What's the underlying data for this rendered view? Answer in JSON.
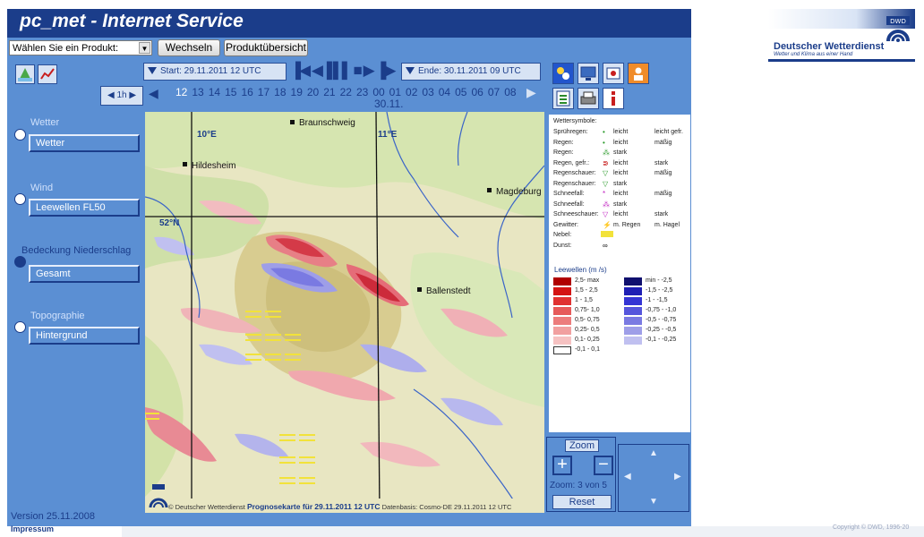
{
  "app": {
    "title": "pc_met - Internet Service",
    "brand_name": "Deutscher Wetterdienst",
    "brand_slogan": "Wetter und Klima aus einer Hand",
    "logo_text": "DWD",
    "colors": {
      "header": "#1b3d8a",
      "panel": "#5b8fd3",
      "field": "#d7e3f4"
    }
  },
  "toolbar": {
    "product_select": "Wählen Sie ein Produkt:",
    "switch_label": "Wechseln",
    "overview_label": "Produktübersicht"
  },
  "timebar": {
    "start": "Start:  29.11.2011 12 UTC",
    "end": "Ende:  30.11.2011 09 UTC",
    "step": "1h",
    "hours": [
      "12",
      "13",
      "14",
      "15",
      "16",
      "17",
      "18",
      "19",
      "20",
      "21",
      "22",
      "23",
      "00",
      "01",
      "02",
      "03",
      "04",
      "05",
      "06",
      "07",
      "08"
    ],
    "active_hour": "12",
    "date_label": "30.11."
  },
  "sidebar": {
    "weather_label": "Wetter",
    "weather_value": "Wetter",
    "wind_label": "Wind",
    "wind_value": "Leewellen FL50",
    "cover_label": "Bedeckung  Niederschlag",
    "cover_value": "Gesamt",
    "topo_label": "Topographie",
    "topo_value": "Hintergrund"
  },
  "map": {
    "cities": [
      "Braunschweig",
      "Hildesheim",
      "Magdeburg",
      "Ballenstedt"
    ],
    "lon1": "10°E",
    "lon2": "11°E",
    "lat1": "52°N",
    "caption_prefix": "© Deutscher Wetterdienst",
    "caption_title": "Prognosekarte für",
    "caption_time": "29.11.2011 12 UTC",
    "caption_basis": "Datenbasis: Cosmo-DE 29.11.2011 12 UTC"
  },
  "legend": {
    "title": "Wettersymbole:",
    "rows": [
      {
        "label": "Sprühregen:",
        "a": "leicht",
        "b": "leicht gefr."
      },
      {
        "label": "Regen:",
        "a": "leicht",
        "b": "mäßig"
      },
      {
        "label": "Regen:",
        "a": "stark",
        "b": ""
      },
      {
        "label": "Regen, gefr.:",
        "a": "leicht",
        "b": "stark"
      },
      {
        "label": "Regenschauer:",
        "a": "leicht",
        "b": "mäßig"
      },
      {
        "label": "Regenschauer:",
        "a": "stark",
        "b": ""
      },
      {
        "label": "Schneefall:",
        "a": "leicht",
        "b": "mäßig"
      },
      {
        "label": "Schneefall:",
        "a": "stark",
        "b": ""
      },
      {
        "label": "Schneeschauer:",
        "a": "leicht",
        "b": "stark"
      },
      {
        "label": "Gewitter:",
        "a": "m. Regen",
        "b": "m. Hagel"
      },
      {
        "label": "Nebel:",
        "a": "",
        "b": ""
      },
      {
        "label": "Dunst:",
        "a": "",
        "b": ""
      }
    ],
    "scale_title": "Leewellen (m /s)",
    "pos": [
      {
        "label": "2,5- max",
        "color": "#b00000"
      },
      {
        "label": "1,5 - 2,5",
        "color": "#d41414"
      },
      {
        "label": "1 - 1,5",
        "color": "#e03232"
      },
      {
        "label": "0,75- 1,0",
        "color": "#e65a5a"
      },
      {
        "label": "0,5- 0,75",
        "color": "#ec7c7c"
      },
      {
        "label": "0,25- 0,5",
        "color": "#f1a0a0"
      },
      {
        "label": "0,1- 0,25",
        "color": "#f6c2c2"
      }
    ],
    "neg": [
      {
        "label": "min -  -2,5",
        "color": "#10106e"
      },
      {
        "label": "-1,5 -  -2,5",
        "color": "#1f1fb4"
      },
      {
        "label": "-1 -  -1,5",
        "color": "#3535d4"
      },
      {
        "label": "-0,75 -  -1,0",
        "color": "#5656dc"
      },
      {
        "label": "-0,5 -  -0,75",
        "color": "#7a7ae2"
      },
      {
        "label": "-0,25 -  -0,5",
        "color": "#9e9ee8"
      },
      {
        "label": "-0,1 -  -0,25",
        "color": "#c0c0f0"
      }
    ],
    "zero": "-0,1 - 0,1"
  },
  "zoom": {
    "title": "Zoom",
    "status": "Zoom: 3 von 5",
    "reset": "Reset",
    "plus": "+",
    "minus": "−"
  },
  "footer": {
    "version": "Version 25.11.2008",
    "impressum": "Impressum",
    "copyright": "Copyright © DWD, 1996-20"
  }
}
